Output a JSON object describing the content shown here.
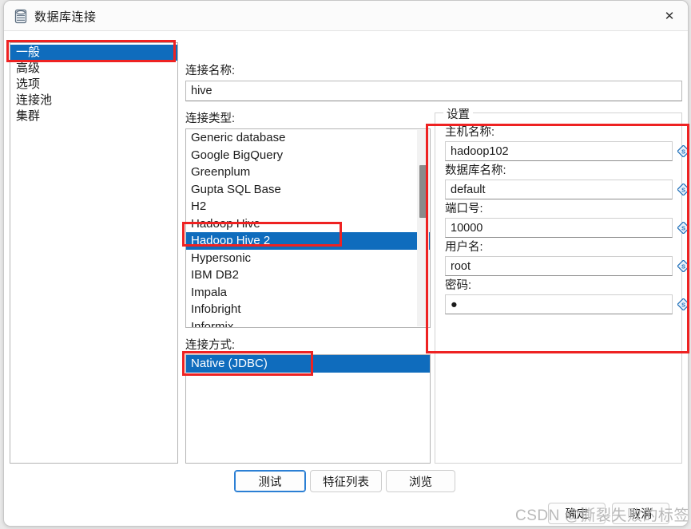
{
  "window": {
    "title": "数据库连接",
    "icon": "database-icon",
    "close_label": "✕"
  },
  "sidebar": {
    "items": [
      {
        "label": "一般",
        "selected": true
      },
      {
        "label": "高级",
        "selected": false
      },
      {
        "label": "选项",
        "selected": false
      },
      {
        "label": "连接池",
        "selected": false
      },
      {
        "label": "集群",
        "selected": false
      }
    ]
  },
  "main": {
    "connection_name_label": "连接名称:",
    "connection_name_value": "hive",
    "connection_type_label": "连接类型:",
    "connection_type_items": [
      {
        "label": "Generic database",
        "selected": false
      },
      {
        "label": "Google BigQuery",
        "selected": false
      },
      {
        "label": "Greenplum",
        "selected": false
      },
      {
        "label": "Gupta SQL Base",
        "selected": false
      },
      {
        "label": "H2",
        "selected": false
      },
      {
        "label": "Hadoop Hive",
        "selected": false
      },
      {
        "label": "Hadoop Hive 2",
        "selected": true
      },
      {
        "label": "Hypersonic",
        "selected": false
      },
      {
        "label": "IBM DB2",
        "selected": false
      },
      {
        "label": "Impala",
        "selected": false
      },
      {
        "label": "Infobright",
        "selected": false
      },
      {
        "label": "Informix",
        "selected": false
      }
    ],
    "connection_method_label": "连接方式:",
    "connection_method_items": [
      {
        "label": "Native (JDBC)",
        "selected": true
      }
    ]
  },
  "settings": {
    "group_title": "设置",
    "fields": [
      {
        "label": "主机名称:",
        "value": "hadoop102",
        "icon": "variable-icon"
      },
      {
        "label": "数据库名称:",
        "value": "default",
        "icon": "variable-icon"
      },
      {
        "label": "端口号:",
        "value": "10000",
        "icon": "variable-icon"
      },
      {
        "label": "用户名:",
        "value": "root",
        "icon": "variable-icon"
      },
      {
        "label": "密码:",
        "value": "●",
        "icon": "variable-icon"
      }
    ]
  },
  "footer": {
    "buttons": [
      {
        "label": "测试",
        "focused": true
      },
      {
        "label": "特征列表",
        "focused": false
      },
      {
        "label": "浏览",
        "focused": false
      }
    ],
    "ok_label": "确定",
    "cancel_label": "取消"
  },
  "watermark": {
    "text": "CSDN @撕裂失败的标签"
  },
  "colors": {
    "selection": "#0f6cbd",
    "annotation": "#ee2222",
    "focus": "#2b7fd4"
  }
}
